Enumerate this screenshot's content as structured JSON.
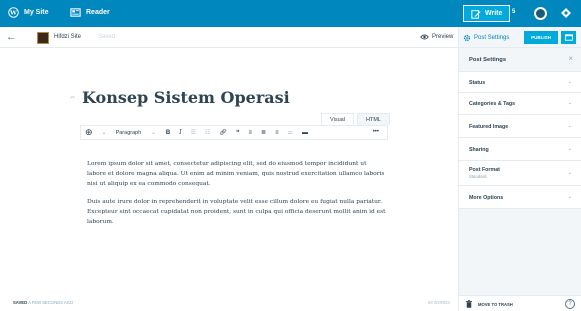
{
  "masterbar": {
    "my_site": "My Site",
    "reader": "Reader",
    "write": "Write",
    "notification_count": "5",
    "icons": [
      "wordpress-icon",
      "reader-icon",
      "write-icon",
      "avatar",
      "notifications-icon"
    ]
  },
  "editor_bar": {
    "site_name": "Hifdzi Site",
    "save_state": "Saved",
    "preview": "Preview"
  },
  "settings_header": {
    "toggle_label": "Post Settings",
    "publish": "PUBLISH"
  },
  "post": {
    "title": "Konsep Sistem Operasi",
    "mode_tabs": [
      "Visual",
      "HTML"
    ],
    "format_select": "Paragraph",
    "paragraphs": [
      "Lorem ipsum dolor sit amet, consectetur adipiscing elit, sed do eiusmod tempor incididunt ut labore et dolore magna aliqua. Ut enim ad minim veniam, quis nostrud exercitation ullamco laboris nisi ut aliquip ex ea commodo consequat.",
      "Duis aute irure dolor in reprehenderit in voluptate velit esse cillum dolore eu fugiat nulla pariatur. Excepteur sint occaecat cupidatat non proident, sunt in culpa qui officia deserunt mollit anim id est laborum."
    ]
  },
  "footer": {
    "saved_prefix": "SAVED",
    "saved_time": "A FEW SECONDS AGO",
    "word_count": "69 WORDS"
  },
  "sidebar": {
    "header": "Post Settings",
    "sections": [
      {
        "label": "Status"
      },
      {
        "label": "Categories & Tags"
      },
      {
        "label": "Featured Image"
      },
      {
        "label": "Sharing"
      },
      {
        "label": "Post Format",
        "value": "Standard"
      },
      {
        "label": "More Options"
      }
    ],
    "trash": "MOVE TO TRASH"
  },
  "colors": {
    "masterbar": "#0087be",
    "accent": "#00aadc",
    "text": "#2e4453",
    "muted": "#87a6bc",
    "panel": "#f3f6f8"
  }
}
